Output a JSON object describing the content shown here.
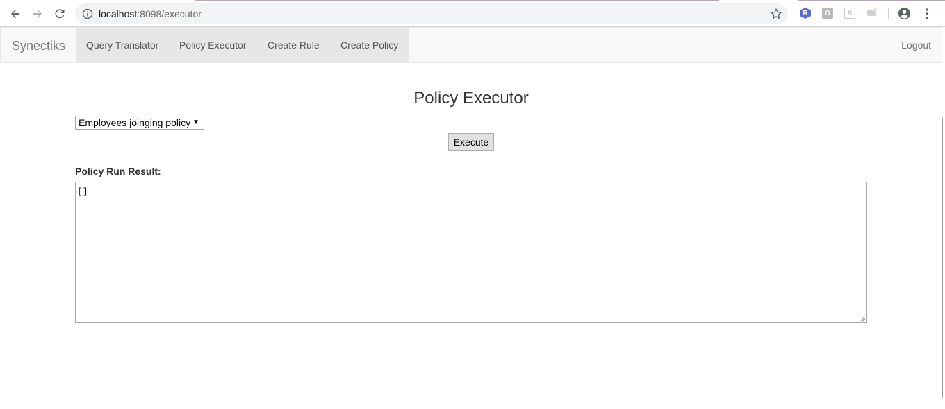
{
  "browser": {
    "url_host": "localhost",
    "url_rest": ":8098/executor"
  },
  "app": {
    "brand": "Synectiks",
    "nav_items": [
      {
        "label": "Query Translator"
      },
      {
        "label": "Policy Executor"
      },
      {
        "label": "Create Rule"
      },
      {
        "label": "Create Policy"
      }
    ],
    "logout_label": "Logout"
  },
  "main": {
    "title": "Policy Executor",
    "policy_select": {
      "selected": "Employees joinging policy"
    },
    "execute_label": "Execute",
    "result_label": "Policy Run Result:",
    "result_value": "[]"
  }
}
